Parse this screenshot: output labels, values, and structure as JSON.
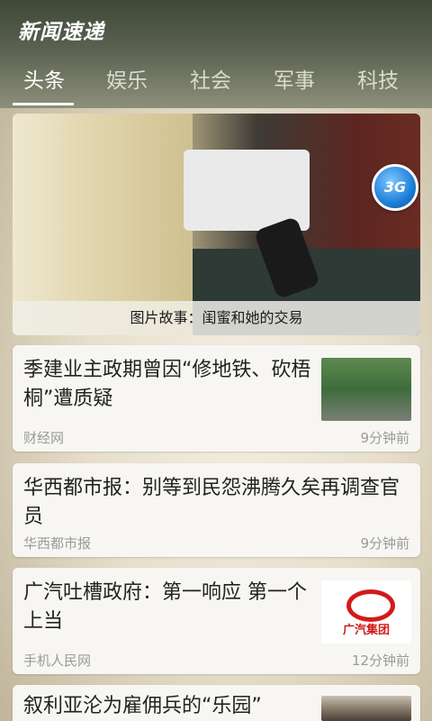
{
  "header": {
    "app_title": "新闻速递",
    "tabs": [
      {
        "label": "头条"
      },
      {
        "label": "娱乐"
      },
      {
        "label": "社会"
      },
      {
        "label": "军事"
      },
      {
        "label": "科技"
      }
    ],
    "active_tab": "头条"
  },
  "hero": {
    "caption": "图片故事：闺蜜和她的交易",
    "badge": "3G"
  },
  "news": [
    {
      "title": "季建业主政期曾因“修地铁、砍梧桐”遭质疑",
      "source": "财经网",
      "time": "9分钟前"
    },
    {
      "title": "华西都市报：别等到民怨沸腾久矣再调查官员",
      "source": "华西都市报",
      "time": "9分钟前"
    },
    {
      "title": "广汽吐槽政府：第一响应 第一个上当",
      "source": "手机人民网",
      "time": "12分钟前",
      "thumb_text": "广汽集团"
    },
    {
      "title": "叙利亚沦为雇佣兵的“乐园”",
      "source": "",
      "time": ""
    }
  ],
  "colors": {
    "header_bg": "#4d5546",
    "card_bg": "#f7f6f2",
    "badge_blue": "#1e7fd8",
    "gac_red": "#d31a1a"
  }
}
